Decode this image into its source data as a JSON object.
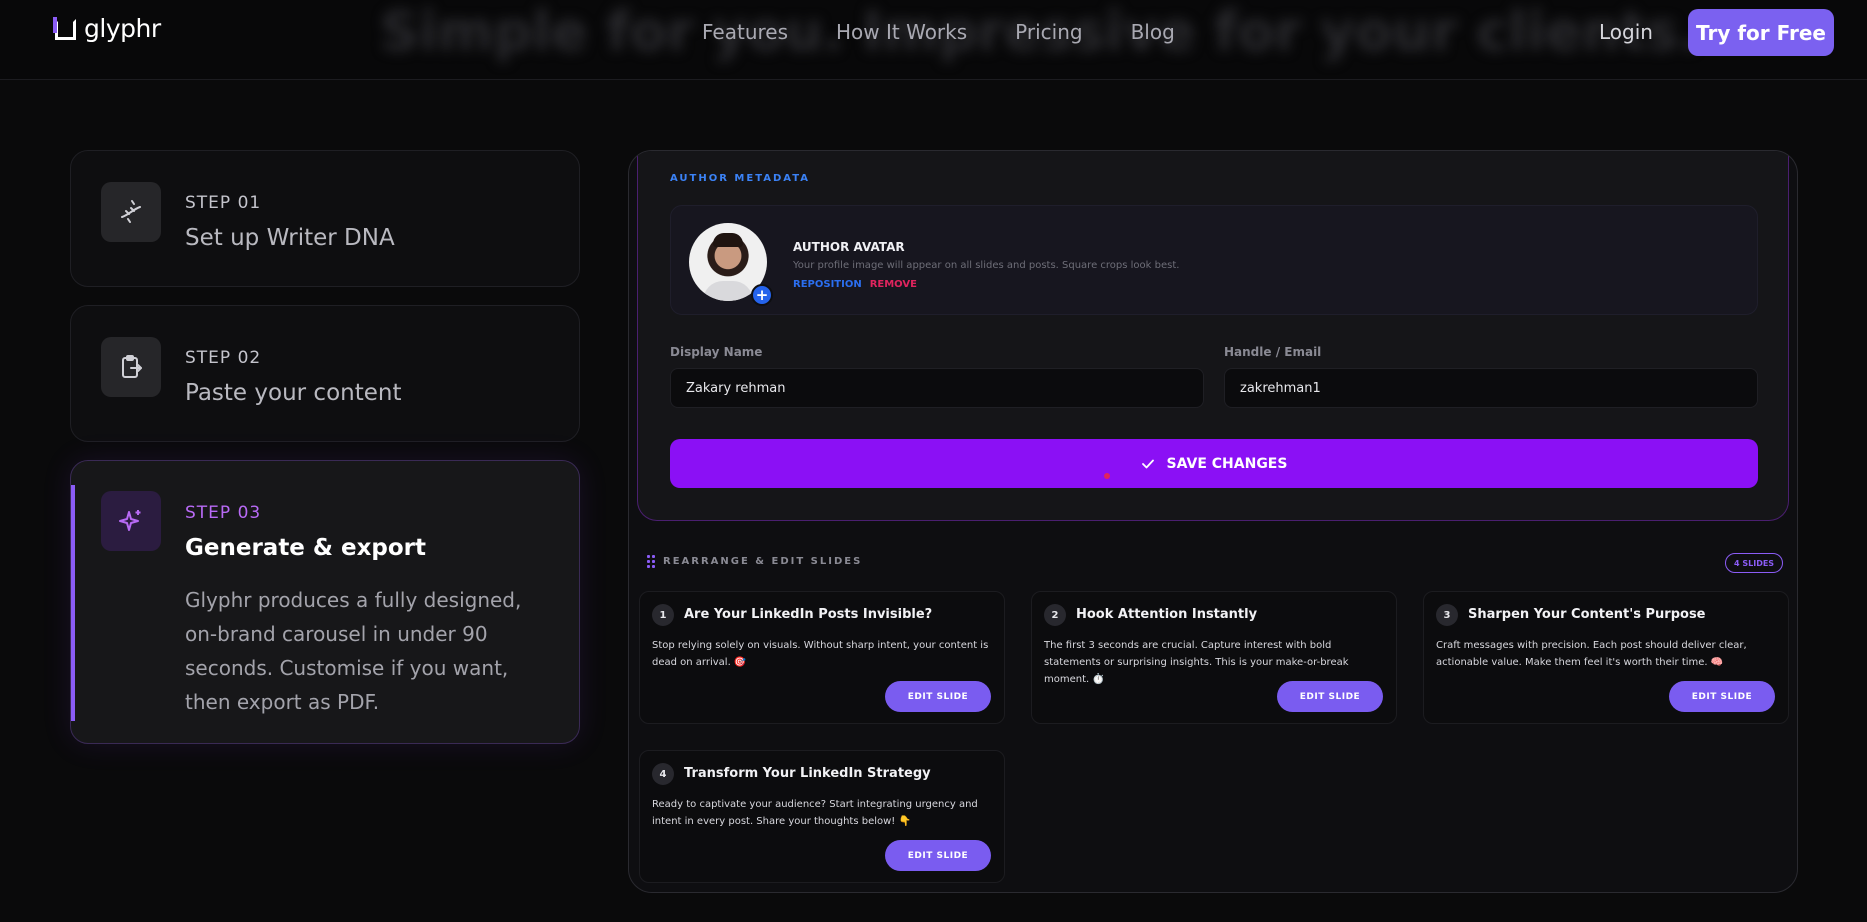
{
  "nav": {
    "logo_text": "glyphr",
    "hero_blur": "Simple for you. Impressive for your clients.",
    "links": [
      "Features",
      "How It Works",
      "Pricing",
      "Blog"
    ],
    "login": "Login",
    "cta": "Try for Free"
  },
  "steps": [
    {
      "num": "STEP 01",
      "title": "Set up Writer DNA",
      "icon": "dna-icon"
    },
    {
      "num": "STEP 02",
      "title": "Paste your content",
      "icon": "clipboard-export-icon"
    },
    {
      "num": "STEP 03",
      "title": "Generate & export",
      "icon": "sparkle-icon",
      "desc": "Glyphr produces a fully designed, on-brand carousel in under 90 seconds. Customise if you want, then export as PDF."
    }
  ],
  "editor": {
    "section_label": "AUTHOR METADATA",
    "avatar_title": "AUTHOR AVATAR",
    "avatar_desc": "Your profile image will appear on all slides and posts. Square crops look best.",
    "reposition": "REPOSITION",
    "remove": "REMOVE",
    "display_name_label": "Display Name",
    "display_name_value": "Zakary rehman",
    "handle_label": "Handle / Email",
    "handle_value": "zakrehman1",
    "save_label": "SAVE CHANGES"
  },
  "slides_section": {
    "title": "REARRANGE & EDIT SLIDES",
    "count_badge": "4 SLIDES",
    "edit_label": "EDIT SLIDE",
    "slides": [
      {
        "n": "1",
        "title": "Are Your LinkedIn Posts Invisible?",
        "desc": "Stop relying solely on visuals. Without sharp intent, your content is dead on arrival. 🎯"
      },
      {
        "n": "2",
        "title": "Hook Attention Instantly",
        "desc": "The first 3 seconds are crucial. Capture interest with bold statements or surprising insights. This is your make-or-break moment. ⏱️"
      },
      {
        "n": "3",
        "title": "Sharpen Your Content's Purpose",
        "desc": "Craft messages with precision. Each post should deliver clear, actionable value. Make them feel it's worth their time. 🧠"
      },
      {
        "n": "4",
        "title": "Transform Your LinkedIn Strategy",
        "desc": "Ready to captivate your audience? Start integrating urgency and intent in every post. Share your thoughts below! 👇"
      }
    ]
  },
  "colors": {
    "accent": "#8b5cf6",
    "save": "#8b10f5",
    "cta": "#7b61f0",
    "link_blue": "#2b6ef0",
    "danger": "#e0245e"
  }
}
